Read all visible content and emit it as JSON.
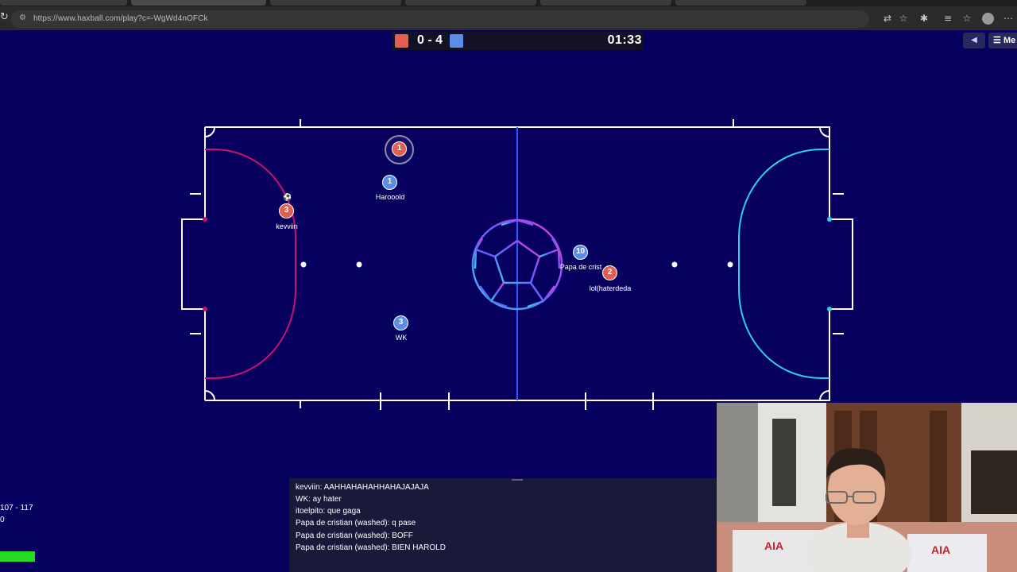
{
  "browser": {
    "url": "https://www.haxball.com/play?c=-WgWd4nOFCk"
  },
  "scoreboard": {
    "score": "0 - 4",
    "timer": "01:33",
    "red_color": "#e35e4f",
    "blue_color": "#5a8ee6"
  },
  "menu": {
    "label": "Me"
  },
  "field": {
    "background": "#07005e",
    "red_area_color": "#c8126c",
    "blue_area_color": "#2fd0ee",
    "midline_color": "#2f5cff"
  },
  "players": [
    {
      "number": "1",
      "team": "red",
      "name": ""
    },
    {
      "number": "1",
      "team": "blue",
      "name": "Harooold"
    },
    {
      "number": "3",
      "team": "red",
      "name": "kevviin"
    },
    {
      "number": "10",
      "team": "blue",
      "name": "Papa de crist"
    },
    {
      "number": "2",
      "team": "red",
      "name": "lol(haterdeda"
    },
    {
      "number": "3",
      "team": "blue",
      "name": "WK"
    }
  ],
  "chat": [
    "kevviin: AAHHAHAHAHHAHAJAJAJA",
    "WK: ay hater",
    "itoelpito: que gaga",
    "Papa de cristian (washed): q pase",
    "Papa de cristian (washed): BOFF",
    "Papa de cristian (washed): BIEN HAROLD"
  ],
  "stats": {
    "line1": "107 - 117",
    "line2": "0"
  }
}
